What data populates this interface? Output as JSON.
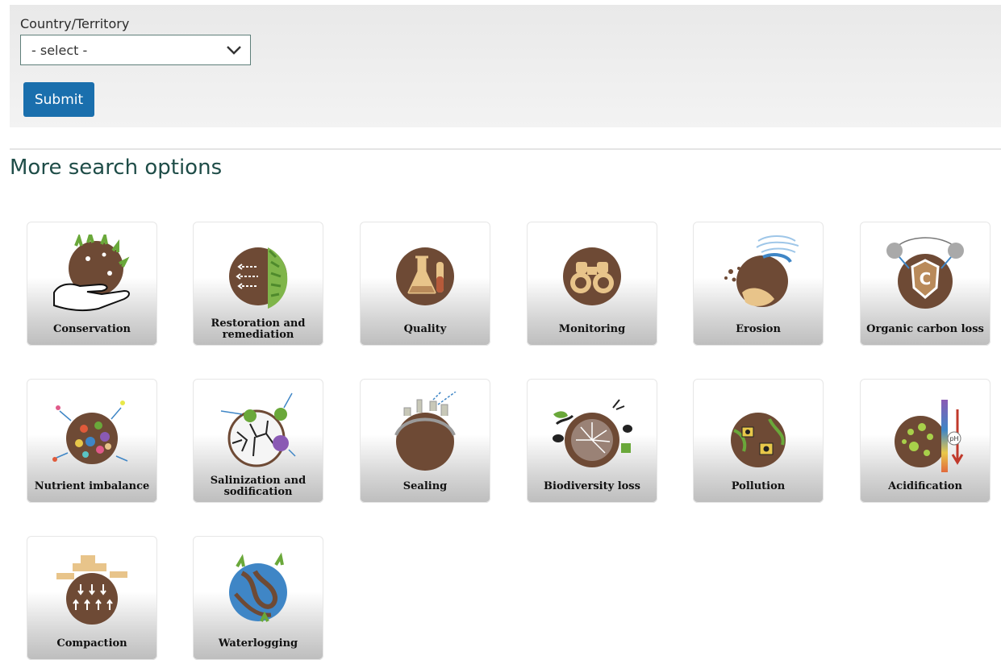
{
  "filter": {
    "label": "Country/Territory",
    "select_value": "- select -",
    "submit_label": "Submit"
  },
  "section_title": "More search options",
  "colors": {
    "soil": "#6e4a35",
    "accent": "#1a6fad",
    "title": "#1f4d48",
    "water": "#3f86c6"
  },
  "tiles": [
    {
      "label": "Conservation",
      "icon": "conservation-icon"
    },
    {
      "label": "Restoration and remediation",
      "icon": "restoration-icon"
    },
    {
      "label": "Quality",
      "icon": "quality-icon"
    },
    {
      "label": "Monitoring",
      "icon": "monitoring-icon"
    },
    {
      "label": "Erosion",
      "icon": "erosion-icon"
    },
    {
      "label": "Organic carbon loss",
      "icon": "organic-carbon-icon"
    },
    {
      "label": "Nutrient imbalance",
      "icon": "nutrient-icon"
    },
    {
      "label": "Salinization and sodification",
      "icon": "salinization-icon"
    },
    {
      "label": "Sealing",
      "icon": "sealing-icon"
    },
    {
      "label": "Biodiversity loss",
      "icon": "biodiversity-icon"
    },
    {
      "label": "Pollution",
      "icon": "pollution-icon"
    },
    {
      "label": "Acidification",
      "icon": "acidification-icon"
    },
    {
      "label": "Compaction",
      "icon": "compaction-icon"
    },
    {
      "label": "Waterlogging",
      "icon": "waterlogging-icon"
    }
  ]
}
